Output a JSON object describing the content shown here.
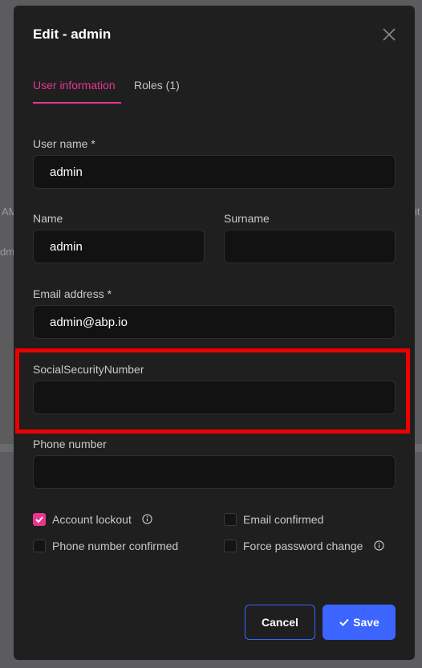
{
  "modal": {
    "title": "Edit - admin"
  },
  "tabs": [
    {
      "label": "User information",
      "active": true
    },
    {
      "label": "Roles (1)",
      "active": false
    }
  ],
  "fields": {
    "username": {
      "label": "User name *",
      "value": "admin"
    },
    "name": {
      "label": "Name",
      "value": "admin"
    },
    "surname": {
      "label": "Surname",
      "value": ""
    },
    "email": {
      "label": "Email address *",
      "value": "admin@abp.io"
    },
    "ssn": {
      "label": "SocialSecurityNumber",
      "value": ""
    },
    "phone": {
      "label": "Phone number",
      "value": ""
    }
  },
  "checkboxes": {
    "account_lockout": {
      "label": "Account lockout",
      "checked": true
    },
    "email_confirmed": {
      "label": "Email confirmed",
      "checked": false
    },
    "phone_confirmed": {
      "label": "Phone number confirmed",
      "checked": false
    },
    "force_password_change": {
      "label": "Force password change",
      "checked": false
    }
  },
  "buttons": {
    "cancel": "Cancel",
    "save": "Save"
  },
  "background": {
    "left_text_1": "AM",
    "left_text_2": "dm",
    "right_text_1": "it"
  },
  "colors": {
    "accent": "#e8368f",
    "primary": "#3c64ff",
    "highlight": "#ee0000",
    "modal_bg": "#1f1f20"
  }
}
